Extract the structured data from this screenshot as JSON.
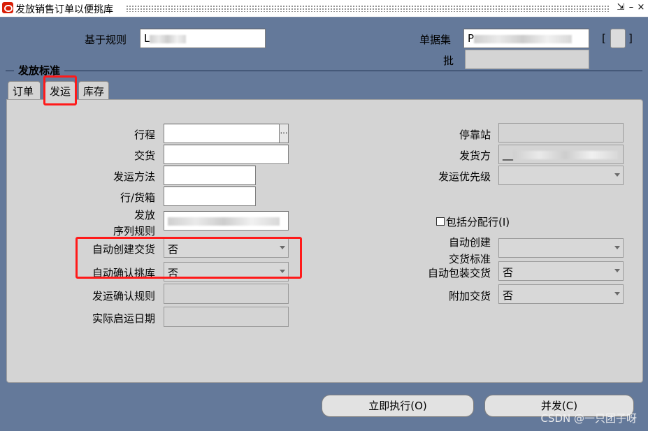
{
  "window": {
    "title": "发放销售订单以便挑库",
    "controls": [
      "⇲",
      "–",
      "×"
    ]
  },
  "header": {
    "rule_label": "基于规则",
    "rule_value": "L",
    "docset_label": "单据集",
    "docset_value": "P",
    "batch_label": "批",
    "bracket_left": "[",
    "bracket_right": "]"
  },
  "section": {
    "title": "发放标准"
  },
  "tabs": [
    {
      "label": "订单"
    },
    {
      "label": "发运"
    },
    {
      "label": "库存"
    }
  ],
  "form_left": {
    "trip_label": "行程",
    "lov": "…",
    "delivery_label": "交货",
    "ship_method_label": "发运方法",
    "line_cont_label": "行/货箱",
    "release_seq_label1": "发放",
    "release_seq_label2": "序列规则",
    "auto_create_label": "自动创建交货",
    "auto_create_value": "否",
    "auto_pick_confirm_label": "自动确认挑库",
    "auto_pick_confirm_value": "否",
    "ship_confirm_rule_label": "发运确认规则",
    "actual_depart_label": "实际启运日期"
  },
  "form_right": {
    "stop_label": "停靠站",
    "ship_from_label": "发货方",
    "ship_from_value": "__",
    "ship_priority_label": "发运优先级",
    "include_assigned_label": "包括分配行(I)",
    "auto_create_crit_label1": "自动创建",
    "auto_create_crit_label2": "交货标准",
    "auto_pack_label": "自动包装交货",
    "auto_pack_value": "否",
    "append_delivery_label": "附加交货",
    "append_delivery_value": "否"
  },
  "buttons": {
    "execute_now": "立即执行(O)",
    "concurrent": "并发(C)"
  },
  "watermark": "CSDN @一只团子呀",
  "colors": {
    "background": "#64799a",
    "panel": "#d4d4d4",
    "highlight": "#ff1a1a",
    "logo": "#d81e06"
  }
}
